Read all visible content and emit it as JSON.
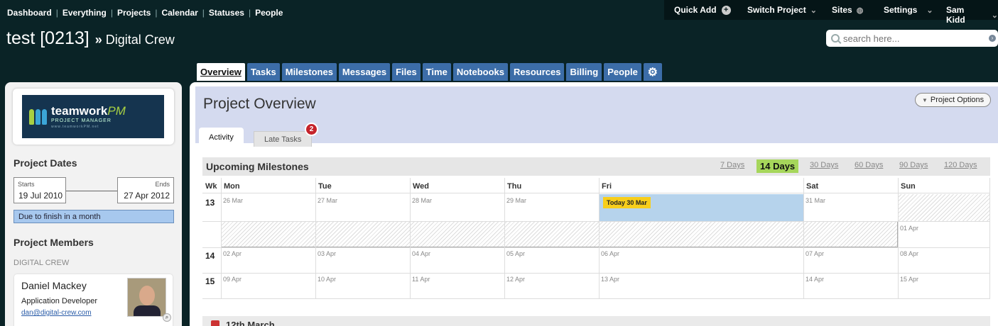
{
  "topnav": [
    "Dashboard",
    "Everything",
    "Projects",
    "Calendar",
    "Statuses",
    "People"
  ],
  "rightbar": {
    "quick_add": "Quick Add",
    "switch_project": "Switch Project",
    "sites": "Sites",
    "settings": "Settings",
    "user": "Sam Kidd"
  },
  "project": {
    "name": "test [0213]",
    "separator": "»",
    "company": "Digital Crew"
  },
  "search": {
    "placeholder": "search here..."
  },
  "tabs": [
    "Overview",
    "Tasks",
    "Milestones",
    "Messages",
    "Files",
    "Time",
    "Notebooks",
    "Resources",
    "Billing",
    "People"
  ],
  "sidebar": {
    "logo": {
      "name": "teamwork",
      "name_accent": "PM",
      "subtitle": "PROJECT MANAGER",
      "url": "www.teamworkPM.net"
    },
    "dates_heading": "Project Dates",
    "starts_label": "Starts",
    "starts": "19 Jul 2010",
    "ends_label": "Ends",
    "ends": "27 Apr 2012",
    "due": "Due to finish in a month",
    "members_heading": "Project Members",
    "company": "DIGITAL CREW",
    "member": {
      "name": "Daniel Mackey",
      "role": "Application Developer",
      "email": "dan@digital-crew.com"
    }
  },
  "main": {
    "title": "Project Overview",
    "options": "Project Options",
    "subtabs": {
      "activity": "Activity",
      "late": "Late Tasks",
      "late_count": "2"
    },
    "upcoming": "Upcoming Milestones",
    "day_options": [
      "7 Days",
      "14 Days",
      "30 Days",
      "60 Days",
      "90 Days",
      "120 Days"
    ],
    "selected_option": "14 Days",
    "next_section": "12th March"
  },
  "calendar": {
    "headers": [
      "Wk",
      "Mon",
      "Tue",
      "Wed",
      "Thu",
      "Fri",
      "Sat",
      "Sun"
    ],
    "weeks": [
      {
        "wk": "13",
        "days": [
          "26 Mar",
          "27 Mar",
          "28 Mar",
          "29 Mar",
          "",
          "31 Mar",
          ""
        ]
      },
      {
        "wk": "",
        "days": [
          "",
          "",
          "",
          "",
          "",
          "",
          "01 Apr"
        ]
      },
      {
        "wk": "14",
        "days": [
          "02 Apr",
          "03 Apr",
          "04 Apr",
          "05 Apr",
          "06 Apr",
          "07 Apr",
          "08 Apr"
        ]
      },
      {
        "wk": "15",
        "days": [
          "09 Apr",
          "10 Apr",
          "11 Apr",
          "12 Apr",
          "13 Apr",
          "14 Apr",
          "15 Apr"
        ]
      }
    ],
    "today_label": "Today 30 Mar"
  },
  "colors": {
    "background": "#0a2326",
    "tab": "#3c6da8",
    "today_cell": "#b6d3ec",
    "today_badge": "#f7ce1b",
    "selected_range": "#a6d65b",
    "late_badge": "#c5232b"
  }
}
